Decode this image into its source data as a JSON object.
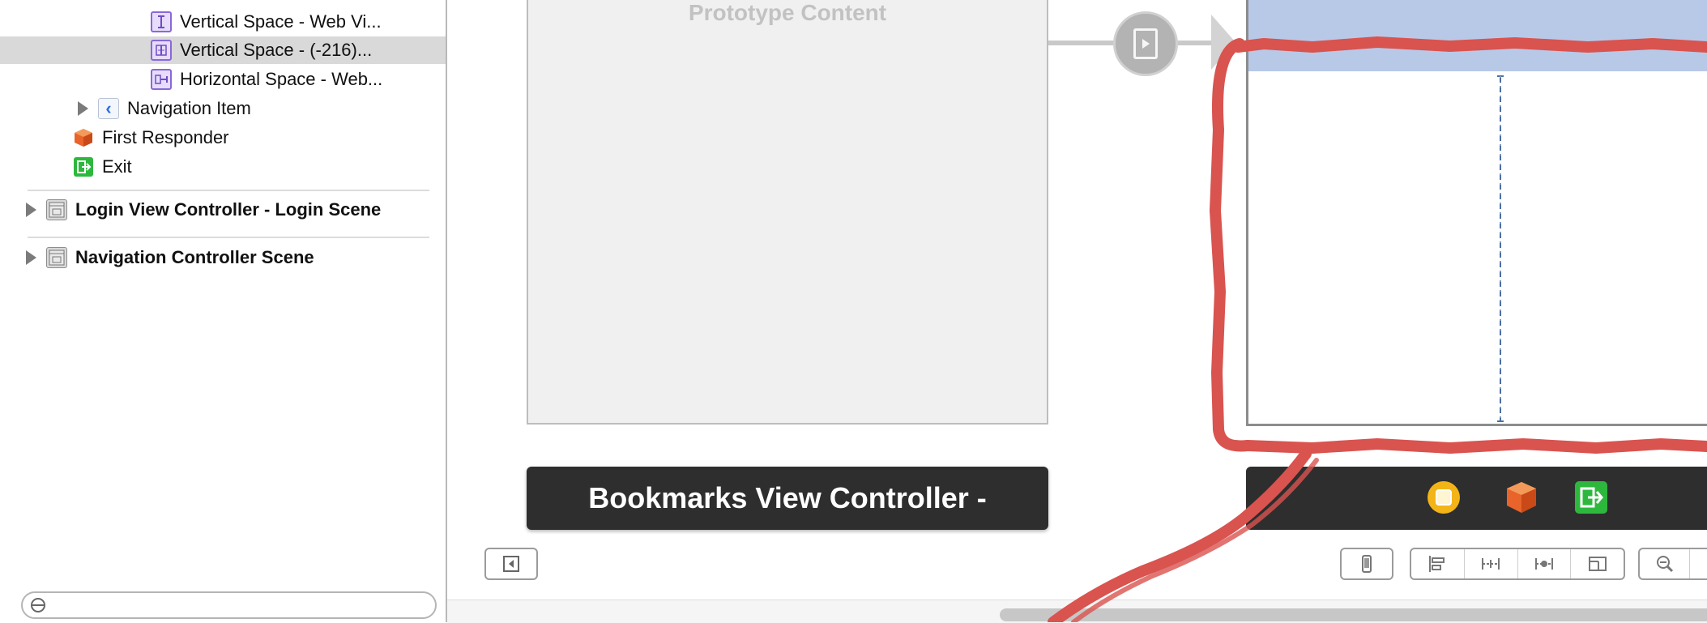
{
  "outline": {
    "items": [
      {
        "label": "Vertical Space - Web Vi...",
        "icon": "vertical-constraint-icon"
      },
      {
        "label": "Vertical Space - (-216)...",
        "icon": "vertical-constraint-icon",
        "selected": true
      },
      {
        "label": "Horizontal Space - Web...",
        "icon": "horizontal-constraint-icon"
      },
      {
        "label": "Navigation Item",
        "icon": "navigation-item-icon",
        "expandable": true
      },
      {
        "label": "First Responder",
        "icon": "first-responder-cube-icon"
      },
      {
        "label": "Exit",
        "icon": "exit-icon"
      }
    ],
    "scenes": [
      {
        "label": "Login View Controller - Login Scene",
        "icon": "scene-icon"
      },
      {
        "label": "Navigation Controller Scene",
        "icon": "scene-icon"
      }
    ],
    "filter": {
      "placeholder": ""
    }
  },
  "canvas": {
    "left_scene": {
      "placeholder_label": "Prototype Content",
      "title": "Bookmarks View Controller -"
    },
    "right_scene": {
      "navbar_color": "#b8c9e8",
      "dock_icons": [
        "first-responder-yellow-icon",
        "cube-icon",
        "exit-icon"
      ]
    },
    "annotation_color": "#d9534f"
  },
  "colors": {
    "selection": "#d9d9d9",
    "constraint_purple": "#8a68d8",
    "scene_bar": "#2e2e2e"
  }
}
